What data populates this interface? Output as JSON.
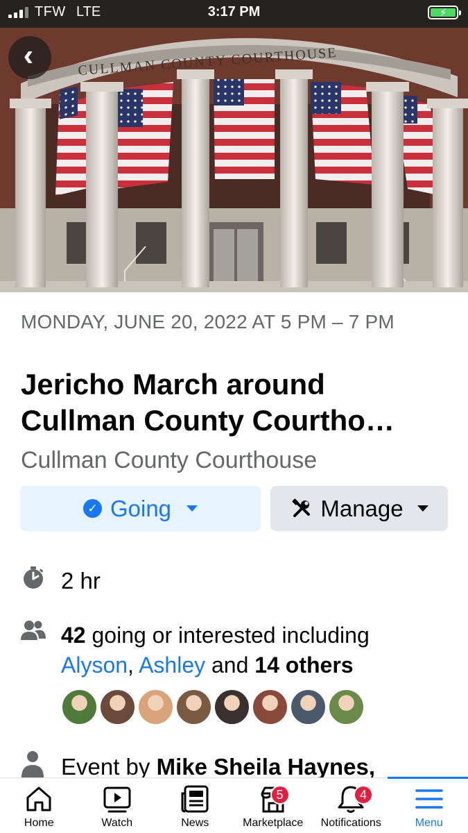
{
  "status_bar": {
    "carrier": "TFW",
    "network": "LTE",
    "time": "3:17 PM"
  },
  "hero": {
    "sign_text": "CULLMAN COUNTY COURTHOUSE"
  },
  "event": {
    "date_line": "MONDAY, JUNE 20, 2022 AT 5 PM – 7 PM",
    "title_line1": "Jericho March around",
    "title_line2": "Cullman County Courtho…",
    "location": "Cullman County Courthouse",
    "going_button": "Going",
    "manage_button": "Manage",
    "duration": "2 hr",
    "attendance": {
      "count": "42",
      "text": " going or interested including",
      "friend1": "Alyson",
      "sep": ", ",
      "friend2": "Ashley",
      "and": " and ",
      "others": "14 others"
    },
    "host_prefix": "Event by ",
    "host_name": "Mike Sheila Haynes,"
  },
  "avatars": [
    {
      "name": "attendee-1",
      "color": "#4f7a3a"
    },
    {
      "name": "attendee-2",
      "color": "#6a4a3a"
    },
    {
      "name": "attendee-3",
      "color": "#d9a47a"
    },
    {
      "name": "attendee-4",
      "color": "#7a5a40"
    },
    {
      "name": "attendee-5",
      "color": "#3a3030"
    },
    {
      "name": "attendee-6",
      "color": "#8a4a3a"
    },
    {
      "name": "attendee-7",
      "color": "#4a5a6a"
    },
    {
      "name": "attendee-8",
      "color": "#6a8a4a"
    }
  ],
  "tabs": [
    {
      "label": "Home",
      "icon": "home-icon"
    },
    {
      "label": "Watch",
      "icon": "watch-icon"
    },
    {
      "label": "News",
      "icon": "news-icon"
    },
    {
      "label": "Marketplace",
      "icon": "marketplace-icon",
      "badge": "5"
    },
    {
      "label": "Notifications",
      "icon": "bell-icon",
      "badge": "4"
    },
    {
      "label": "Menu",
      "icon": "menu-icon",
      "active": true
    }
  ],
  "colors": {
    "accent": "#1877f2",
    "badge": "#e41e3f",
    "secondary_text": "#65676b"
  }
}
